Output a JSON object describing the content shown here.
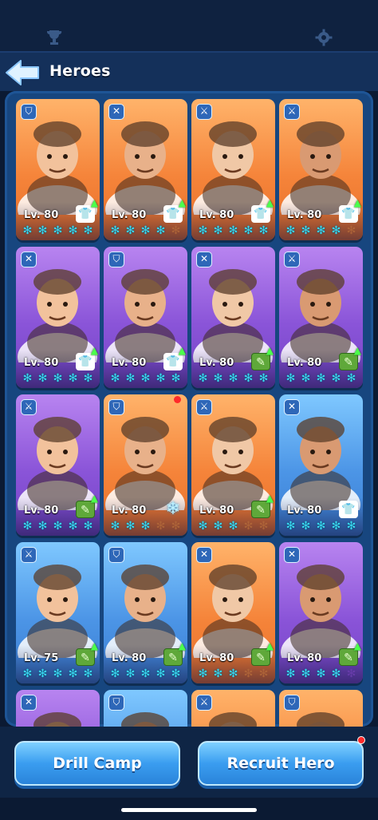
{
  "topbar": {
    "left_icon": "trophy-icon",
    "right_icon": "gear-icon"
  },
  "header": {
    "title": "Heroes",
    "back_icon": "back-arrow-icon"
  },
  "heroes": [
    {
      "name": "masked-warrior",
      "color": "orange",
      "role": "shield-icon",
      "level": "Lv. 80",
      "stars": 5,
      "upgrade": "gear",
      "arrow": true
    },
    {
      "name": "blond-nobleman",
      "color": "orange",
      "role": "crossbow-icon",
      "level": "Lv. 80",
      "stars": 4,
      "upgrade": "gear",
      "arrow": true
    },
    {
      "name": "goggles-girl",
      "color": "orange",
      "role": "sword-icon",
      "level": "Lv. 80",
      "stars": 5,
      "upgrade": "gear",
      "arrow": true
    },
    {
      "name": "pink-hat-lady",
      "color": "orange",
      "role": "sword-icon",
      "level": "Lv. 80",
      "stars": 4,
      "upgrade": "gear",
      "arrow": true
    },
    {
      "name": "aviator-boy",
      "color": "purple",
      "role": "crossbow-icon",
      "level": "Lv. 80",
      "stars": 5,
      "upgrade": "gear",
      "arrow": true
    },
    {
      "name": "blue-helmet-man",
      "color": "purple",
      "role": "shield-icon",
      "level": "Lv. 80",
      "stars": 5,
      "upgrade": "gear",
      "arrow": true
    },
    {
      "name": "red-hair-girl",
      "color": "purple",
      "role": "crossbow-icon",
      "level": "Lv. 80",
      "stars": 5,
      "upgrade": "book",
      "arrow": true
    },
    {
      "name": "viking-engineer",
      "color": "purple",
      "role": "sword-icon",
      "level": "Lv. 80",
      "stars": 5,
      "upgrade": "book",
      "arrow": true
    },
    {
      "name": "chef",
      "color": "purple",
      "role": "sword-icon",
      "level": "Lv. 80",
      "stars": 5,
      "upgrade": "book",
      "arrow": true
    },
    {
      "name": "grey-beard",
      "color": "orange",
      "role": "shield-icon",
      "level": "Lv. 80",
      "stars": 3,
      "upgrade": "star",
      "arrow": false,
      "dot": true
    },
    {
      "name": "plague-doctor",
      "color": "orange",
      "role": "sword-icon",
      "level": "Lv. 80",
      "stars": 3,
      "upgrade": "book",
      "arrow": true
    },
    {
      "name": "blonde-girl",
      "color": "blue",
      "role": "crossbow-icon",
      "level": "Lv. 80",
      "stars": 5,
      "upgrade": "gear",
      "arrow": false
    },
    {
      "name": "yellow-cap-man",
      "color": "blue",
      "role": "sword-icon",
      "level": "Lv. 75",
      "stars": 5,
      "upgrade": "book",
      "arrow": true
    },
    {
      "name": "green-hat-dwarf",
      "color": "blue",
      "role": "shield-icon",
      "level": "Lv. 80",
      "stars": 5,
      "upgrade": "book",
      "arrow": true
    },
    {
      "name": "miner-lady",
      "color": "orange",
      "role": "crossbow-icon",
      "level": "Lv. 80",
      "stars": 3,
      "upgrade": "book",
      "arrow": true
    },
    {
      "name": "desert-warrior",
      "color": "purple",
      "role": "crossbow-icon",
      "level": "Lv. 80",
      "stars": 4,
      "upgrade": "book",
      "arrow": true
    },
    {
      "name": "partial-1",
      "color": "purple",
      "role": "crossbow-icon",
      "level": "",
      "stars": 0,
      "upgrade": "",
      "arrow": false
    },
    {
      "name": "partial-2",
      "color": "blue",
      "role": "shield-icon",
      "level": "",
      "stars": 0,
      "upgrade": "",
      "arrow": false
    },
    {
      "name": "partial-3",
      "color": "orange",
      "role": "sword-icon",
      "level": "",
      "stars": 0,
      "upgrade": "",
      "arrow": false
    },
    {
      "name": "partial-4",
      "color": "orange",
      "role": "shield-icon",
      "level": "",
      "stars": 0,
      "upgrade": "",
      "arrow": false
    }
  ],
  "buttons": {
    "drill": "Drill Camp",
    "recruit": "Recruit Hero"
  }
}
